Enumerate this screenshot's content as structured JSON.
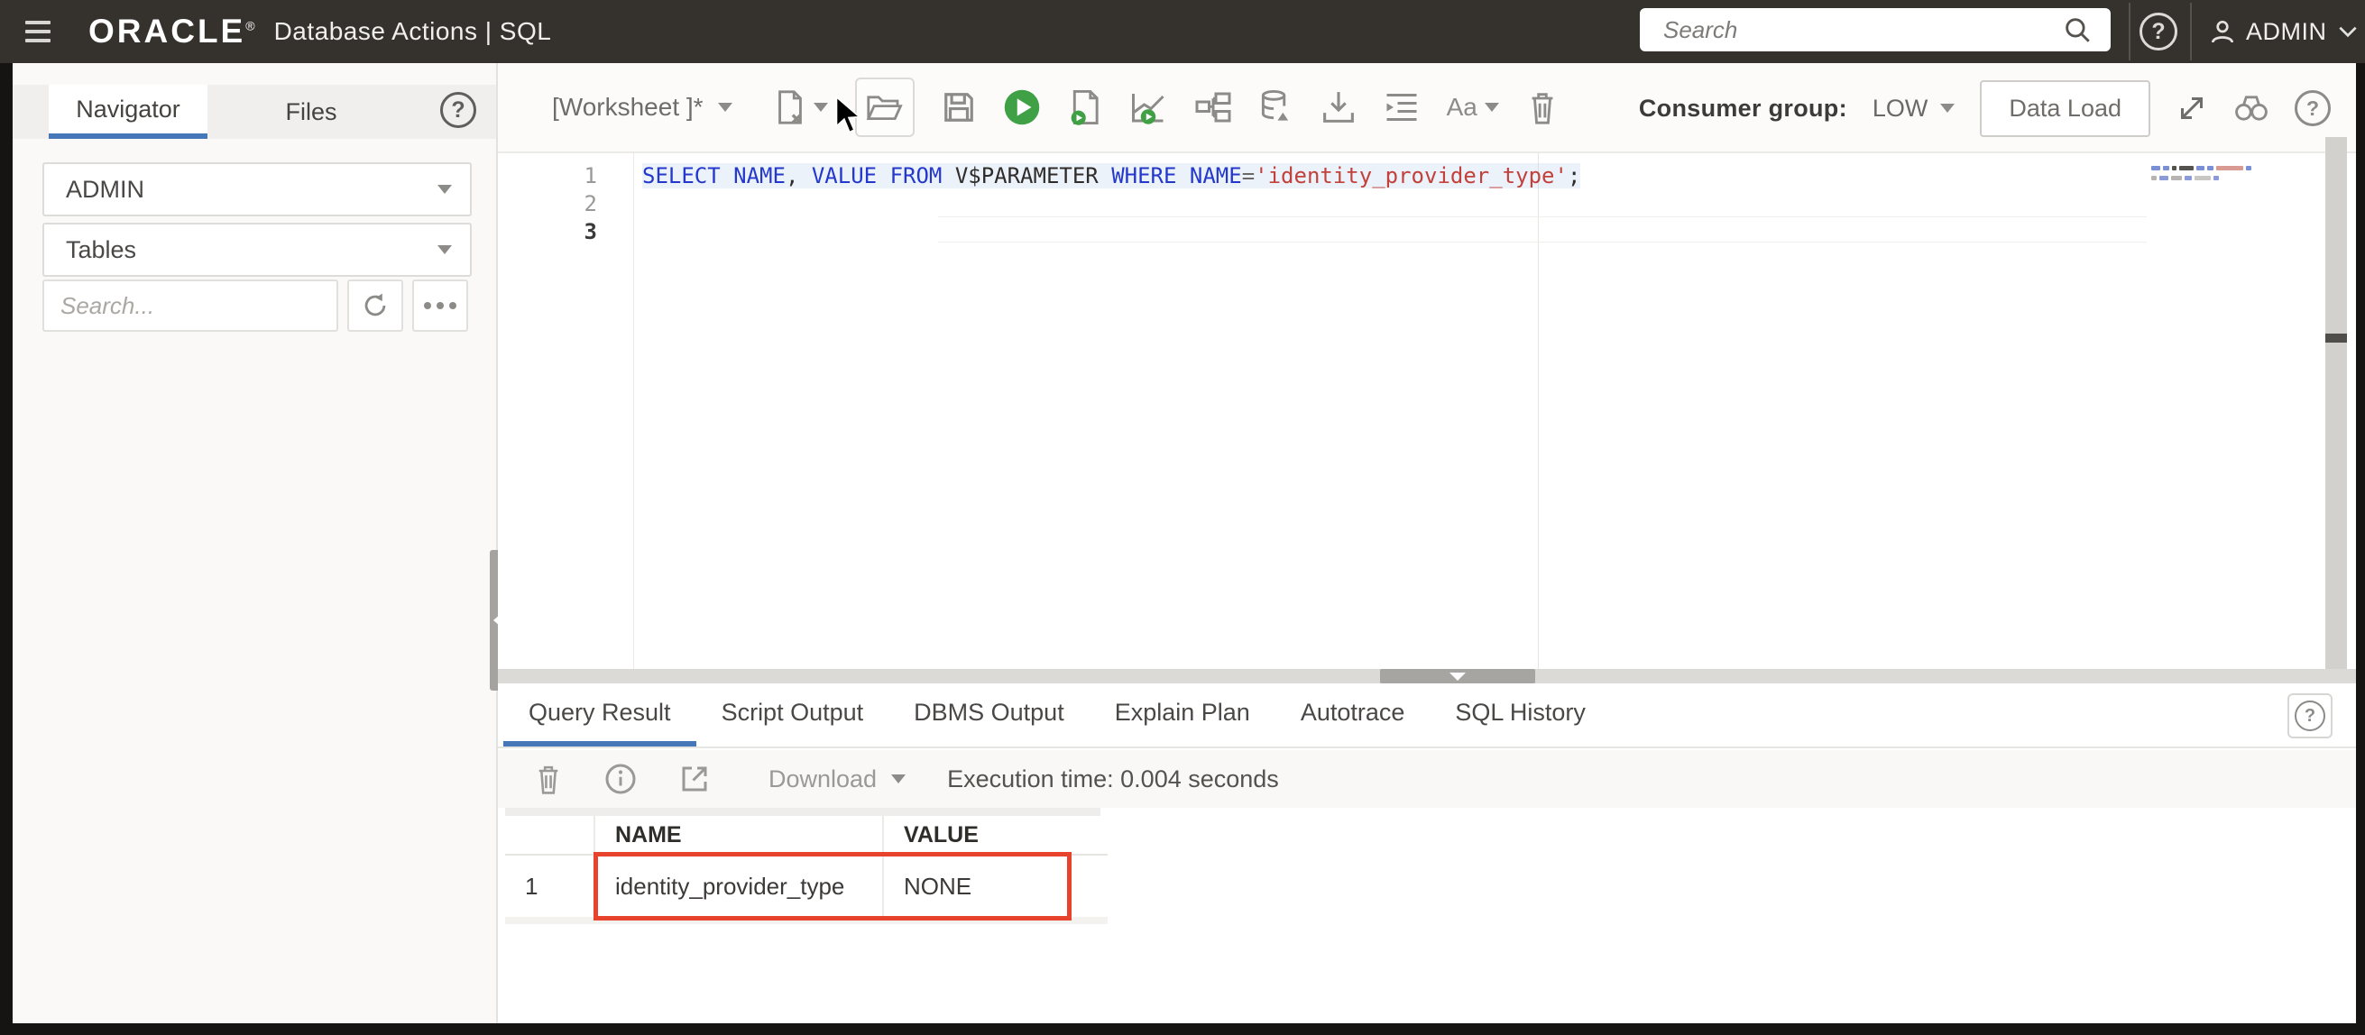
{
  "colors": {
    "topbar_bg": "#35322e",
    "accent_blue": "#4677b8",
    "run_green": "#3fa045",
    "keyword_blue": "#2438cc",
    "string_red": "#c2413b",
    "highlight_red": "#e8432c"
  },
  "topbar": {
    "logo": "ORACLE",
    "logo_mark": "®",
    "product": "Database Actions | SQL",
    "search_placeholder": "Search",
    "help_glyph": "?",
    "user": "ADMIN"
  },
  "sidebar": {
    "tabs": [
      "Navigator",
      "Files"
    ],
    "help_glyph": "?",
    "schema_select": "ADMIN",
    "object_type_select": "Tables",
    "search_placeholder": "Search..."
  },
  "worksheet": {
    "title": "[Worksheet ]*",
    "font_button": "Aa",
    "consumer_group_label": "Consumer group:",
    "consumer_group_value": "LOW",
    "data_load_label": "Data Load",
    "help_glyph": "?"
  },
  "editor": {
    "line_numbers": [
      "1",
      "2",
      "3"
    ],
    "tokens": [
      "SELECT ",
      "NAME",
      ", ",
      "VALUE ",
      "FROM ",
      "V$PARAMETER ",
      "WHERE ",
      "NAME",
      "=",
      "'identity_provider_type'",
      ";"
    ],
    "sql": "SELECT NAME, VALUE FROM V$PARAMETER WHERE NAME='identity_provider_type';"
  },
  "results": {
    "tabs": [
      "Query Result",
      "Script Output",
      "DBMS Output",
      "Explain Plan",
      "Autotrace",
      "SQL History"
    ],
    "active_tab": "Query Result",
    "help_glyph": "?",
    "download_label": "Download",
    "execution_time": "Execution time: 0.004 seconds",
    "table": {
      "columns": [
        "NAME",
        "VALUE"
      ],
      "rows": [
        {
          "num": "1",
          "name": "identity_provider_type",
          "value": "NONE"
        }
      ]
    }
  }
}
